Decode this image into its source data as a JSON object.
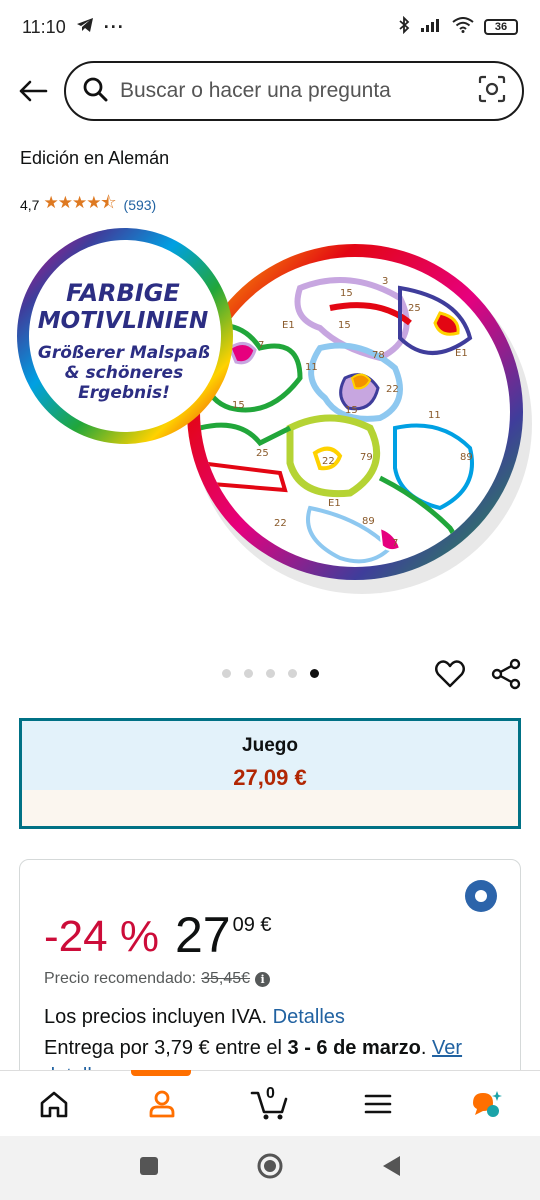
{
  "status_bar": {
    "time": "11:10",
    "battery": "36",
    "icons": [
      "telegram-icon",
      "more-dots-icon",
      "bluetooth-icon",
      "signal-icon",
      "wifi-icon",
      "battery-icon"
    ]
  },
  "search": {
    "placeholder": "Buscar o hacer una pregunta"
  },
  "product": {
    "edition": "Edición en Alemán",
    "rating": "4,7",
    "rating_count": "(593)",
    "stars": "★★★★⯪",
    "image": {
      "badge_line1": "FARBIGE",
      "badge_line2": "MOTIVLINIEN",
      "badge_line3": "Größerer Malspaß",
      "badge_line4": "& schöneres",
      "badge_line5": "Ergebnis!",
      "map_numbers": [
        "15",
        "3",
        "25",
        "E1",
        "7",
        "15",
        "78",
        "E1",
        "11",
        "22",
        "15",
        "15",
        "11",
        "25",
        "22",
        "79",
        "89",
        "E1",
        "22",
        "89",
        "7"
      ]
    },
    "carousel": {
      "count": 5,
      "active_index": 4
    }
  },
  "format": {
    "name": "Juego",
    "price": "27,09 €"
  },
  "offer": {
    "discount": "-24 %",
    "price_whole": "27",
    "price_fraction": "09 €",
    "rrp_label": "Precio recomendado:",
    "rrp_value": "35,45€",
    "vat_text": "Los precios incluyen IVA.",
    "vat_link": "Detalles",
    "delivery_prefix": "Entrega por 3,79 € entre el",
    "delivery_dates": "3 - 6 de marzo",
    "delivery_link": "Ver detalles"
  },
  "bottom_nav": {
    "cart_count": "0",
    "items": [
      "home-icon",
      "account-icon",
      "cart-icon",
      "menu-icon",
      "rufus-icon"
    ],
    "active": "account-icon"
  },
  "colors": {
    "accent_orange": "#ff6f00",
    "link_blue": "#2162a1",
    "discount_red": "#cc0c39",
    "price_red": "#b12704",
    "format_border": "#007185",
    "star_orange": "#de7921"
  }
}
